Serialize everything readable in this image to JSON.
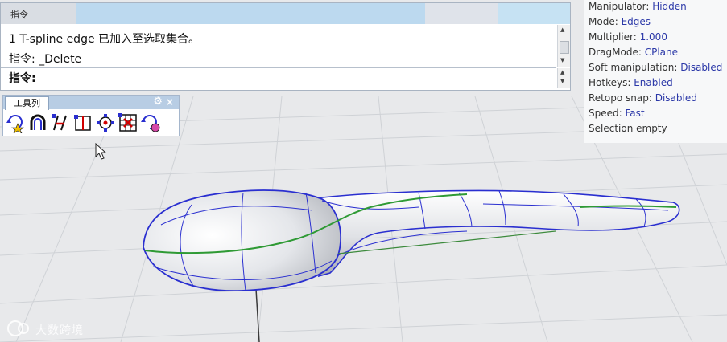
{
  "command_window": {
    "title": "指令",
    "history": [
      "1 T-spline edge 已加入至选取集合。",
      "指令: _Delete"
    ],
    "prompt": "指令:"
  },
  "toolbar": {
    "title": "工具列",
    "tools": [
      "rotate-star-icon",
      "arch-magnet-icon",
      "edge-insert-icon",
      "book-icon",
      "circle-snap-icon",
      "grid-select-icon",
      "rotate-circle-icon"
    ]
  },
  "status": {
    "rows": [
      {
        "label": "Manipulator:",
        "value": "Hidden"
      },
      {
        "label": "Mode:",
        "value": "Edges"
      },
      {
        "label": "Multiplier:",
        "value": "1.000"
      },
      {
        "label": "DragMode:",
        "value": "CPlane"
      },
      {
        "label": "Soft manipulation:",
        "value": "Disabled"
      },
      {
        "label": "Hotkeys:",
        "value": "Enabled"
      },
      {
        "label": "Retopo snap:",
        "value": "Disabled"
      },
      {
        "label": "Speed:",
        "value": "Fast"
      },
      {
        "label": "Selection empty",
        "value": ""
      }
    ]
  },
  "watermark": "大数跨境",
  "colors": {
    "wire_blue": "#2a2fd0",
    "selected_edge": "#2f9a35",
    "grid": "#d2d4d8",
    "status_value": "#2b38a8"
  }
}
